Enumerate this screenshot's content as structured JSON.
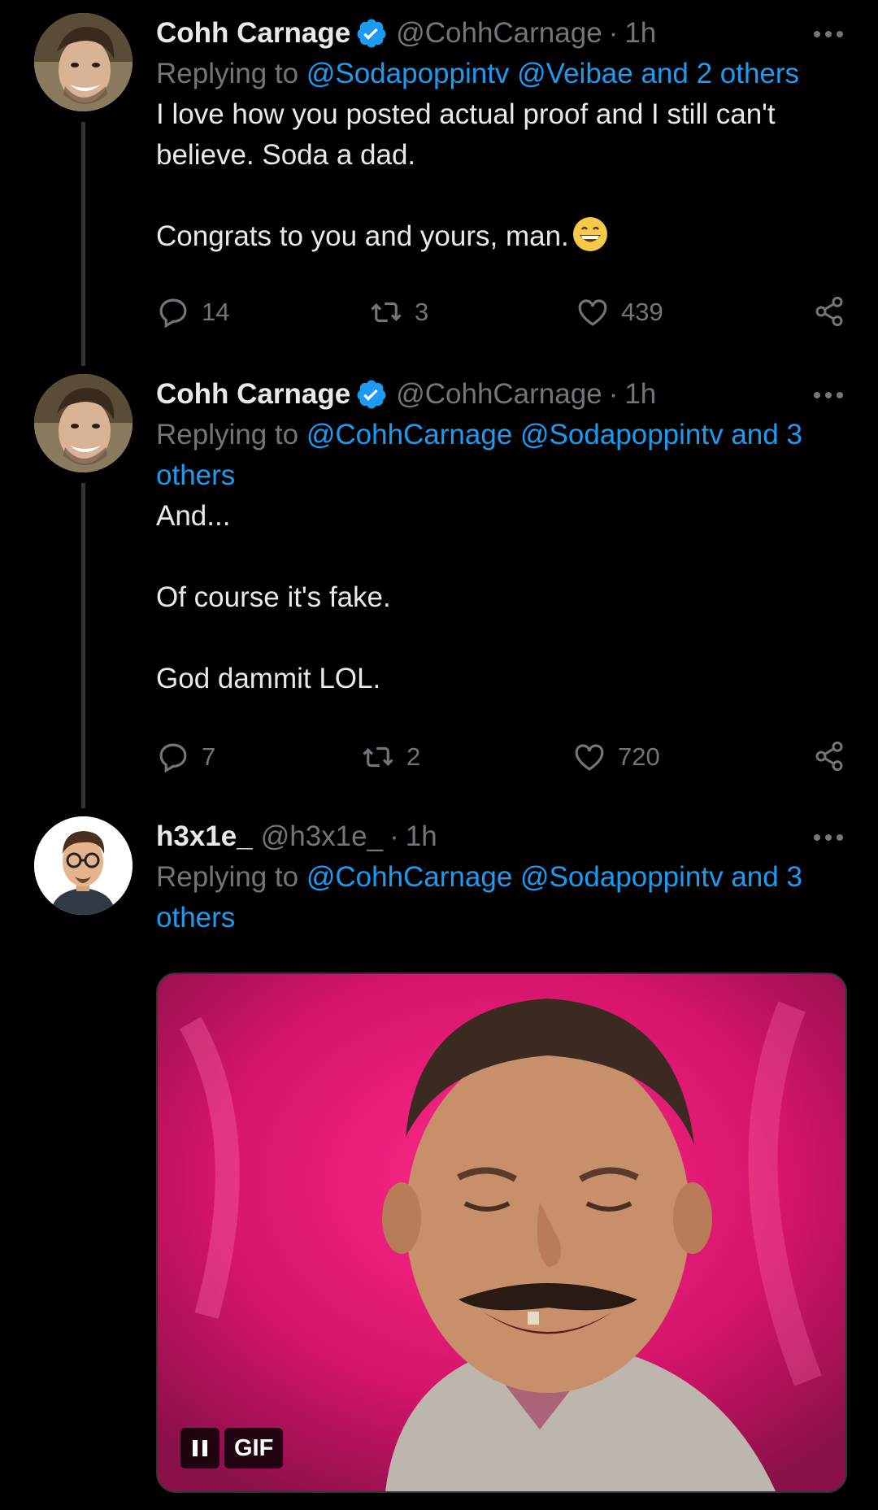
{
  "tweets": [
    {
      "name": "Cohh Carnage",
      "verified": true,
      "handle": "@CohhCarnage",
      "time": "1h",
      "replying_prefix": "Replying to ",
      "replying_mentions": "@Sodapoppintv @Veibae and 2 others",
      "text": "I love how you posted actual proof and I still can't believe. Soda a dad.\n\nCongrats to you and yours, man.",
      "emoji": "grinning-face-emoji",
      "replies": "14",
      "retweets": "3",
      "likes": "439"
    },
    {
      "name": "Cohh Carnage",
      "verified": true,
      "handle": "@CohhCarnage",
      "time": "1h",
      "replying_prefix": "Replying to ",
      "replying_mentions": "@CohhCarnage @Sodapoppintv and 3 others",
      "text": "And...\n\nOf course it's fake.\n\nGod dammit LOL.",
      "replies": "7",
      "retweets": "2",
      "likes": "720"
    },
    {
      "name": "h3x1e_",
      "verified": false,
      "handle": "@h3x1e_",
      "time": "1h",
      "replying_prefix": "Replying to ",
      "replying_mentions": "@CohhCarnage @Sodapoppintv and 3 others",
      "media": {
        "type": "gif",
        "badge": "GIF",
        "description_icon": "laughing-man-gif"
      }
    }
  ],
  "separator": "·",
  "colors": {
    "background": "#000000",
    "text": "#e7e9ea",
    "muted": "#71767b",
    "link": "#1d9bf0",
    "verified": "#1d9bf0"
  }
}
